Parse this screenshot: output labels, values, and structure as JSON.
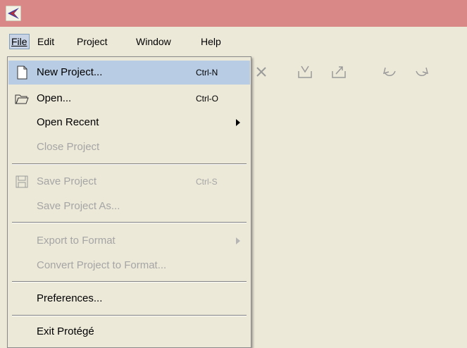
{
  "menubar": {
    "items": [
      {
        "label": "File"
      },
      {
        "label": "Edit"
      },
      {
        "label": "Project"
      },
      {
        "label": "Window"
      },
      {
        "label": "Help"
      }
    ]
  },
  "file_menu": {
    "new_project": {
      "label": "New Project...",
      "shortcut": "Ctrl-N",
      "icon": "new-document-icon"
    },
    "open": {
      "label": "Open...",
      "shortcut": "Ctrl-O",
      "icon": "open-folder-icon"
    },
    "open_recent": {
      "label": "Open Recent"
    },
    "close_project": {
      "label": "Close Project"
    },
    "save_project": {
      "label": "Save Project",
      "shortcut": "Ctrl-S",
      "icon": "save-disk-icon"
    },
    "save_project_as": {
      "label": "Save Project As..."
    },
    "export_to_format": {
      "label": "Export to Format"
    },
    "convert_project": {
      "label": "Convert Project to Format..."
    },
    "preferences": {
      "label": "Preferences..."
    },
    "exit": {
      "label": "Exit Protégé"
    }
  },
  "colors": {
    "titlebar": "#d98787",
    "background": "#ece9d8",
    "highlight": "#b8cce4",
    "disabled_text": "#a5a5a5"
  },
  "toolbar_icons": [
    "delete-icon",
    "import-icon",
    "export-icon",
    "undo-icon",
    "redo-icon"
  ]
}
